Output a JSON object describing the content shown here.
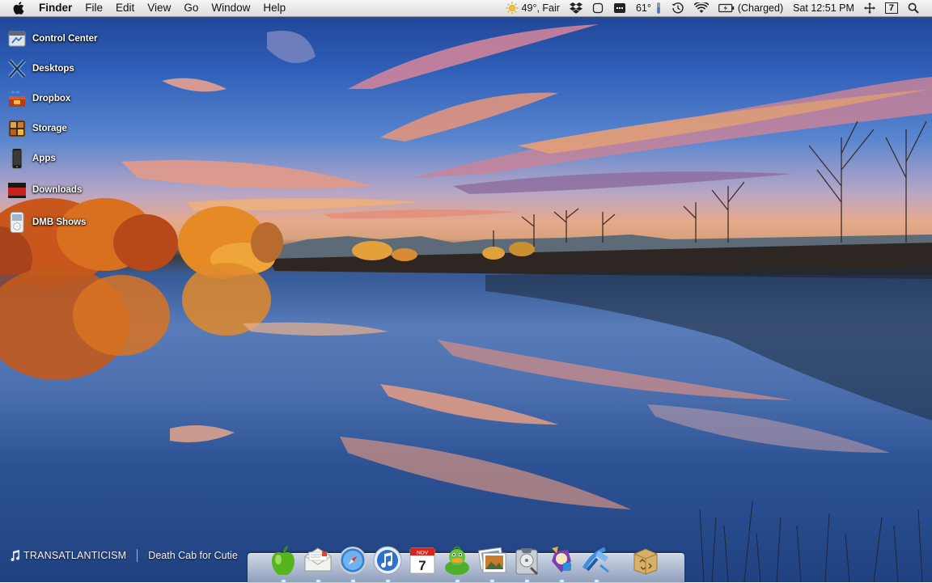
{
  "menubar": {
    "apple_icon": "apple-icon",
    "app_name": "Finder",
    "menus": [
      "File",
      "Edit",
      "View",
      "Go",
      "Window",
      "Help"
    ],
    "status": {
      "weather": "49°, Fair",
      "temperature": "61°",
      "battery": "(Charged)",
      "clock": "Sat 12:51 PM",
      "space_number": "7"
    }
  },
  "desktop_icons": [
    {
      "label": "Control Center",
      "icon": "control-center-icon"
    },
    {
      "label": "Desktops",
      "icon": "desktops-icon"
    },
    {
      "label": "Dropbox",
      "icon": "dropbox-icon"
    },
    {
      "label": "Storage",
      "icon": "storage-icon"
    },
    {
      "label": "Apps",
      "icon": "apps-icon"
    },
    {
      "label": "Downloads",
      "icon": "downloads-icon"
    },
    {
      "label": "DMB Shows",
      "icon": "dmb-shows-icon"
    }
  ],
  "now_playing": {
    "album": "TRANSATLANTICISM",
    "artist": "Death Cab for Cutie"
  },
  "dock": {
    "apps": [
      "finder-apple",
      "mail",
      "safari",
      "itunes",
      "ical",
      "adium",
      "preview",
      "disk-utility",
      "growl",
      "xcode",
      "trash"
    ],
    "calendar_month": "NOV",
    "calendar_day": "7"
  },
  "colors": {
    "menubar_bg": "#e8e8e8",
    "label_text": "#ffffff",
    "sky_blue": "#2f5fb8",
    "autumn_orange": "#e0761e"
  }
}
